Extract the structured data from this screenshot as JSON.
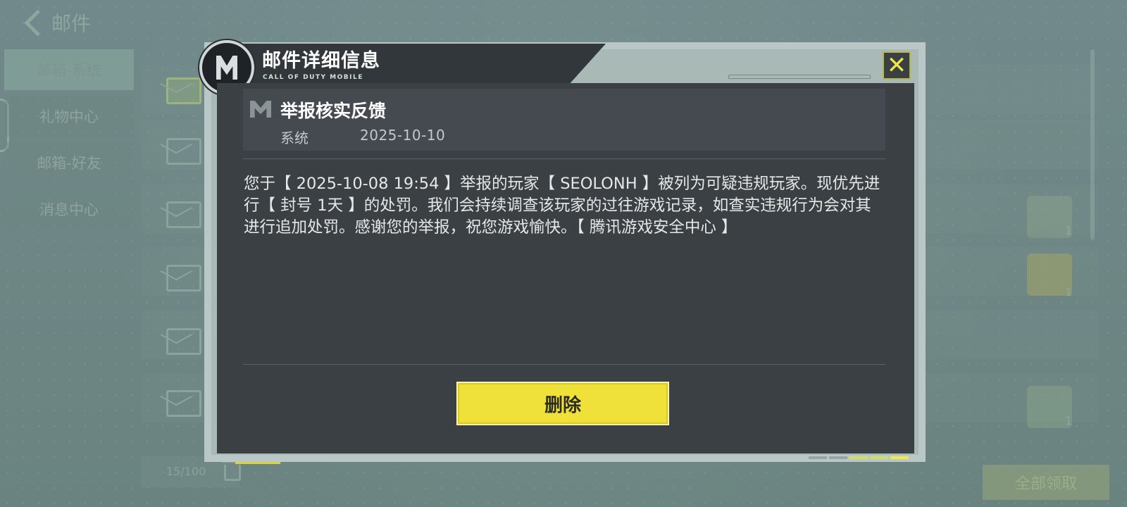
{
  "background": {
    "header_title": "邮件",
    "side_tabs": [
      "邮箱-系统",
      "礼物中心",
      "邮箱-好友",
      "消息中心"
    ],
    "active_tab_index": 0,
    "mail_count": "15/100",
    "collect_all_label": "全部领取",
    "right_counts": [
      "1",
      "1",
      "1"
    ]
  },
  "modal": {
    "title": "邮件详细信息",
    "brand_subtitle": "CALL OF DUTY MOBILE",
    "close_symbol": "✕",
    "mail": {
      "subject": "举报核实反馈",
      "sender": "系统",
      "date": "2025-10-10",
      "body": "您于【 2025-10-08 19:54 】举报的玩家【 SEOLONH 】被列为可疑违规玩家。现优先进行【 封号 1天 】的处罚。我们会持续调查该玩家的过往游戏记录，如查实违规行为会对其进行追加处罚。感谢您的举报，祝您游戏愉快。【 腾讯游戏安全中心 】"
    },
    "delete_label": "删除"
  },
  "colors": {
    "accent_yellow": "#f0e03a",
    "panel_dark": "#3b4045",
    "frame_light": "#b9c8c6",
    "background": "#6f8884"
  }
}
